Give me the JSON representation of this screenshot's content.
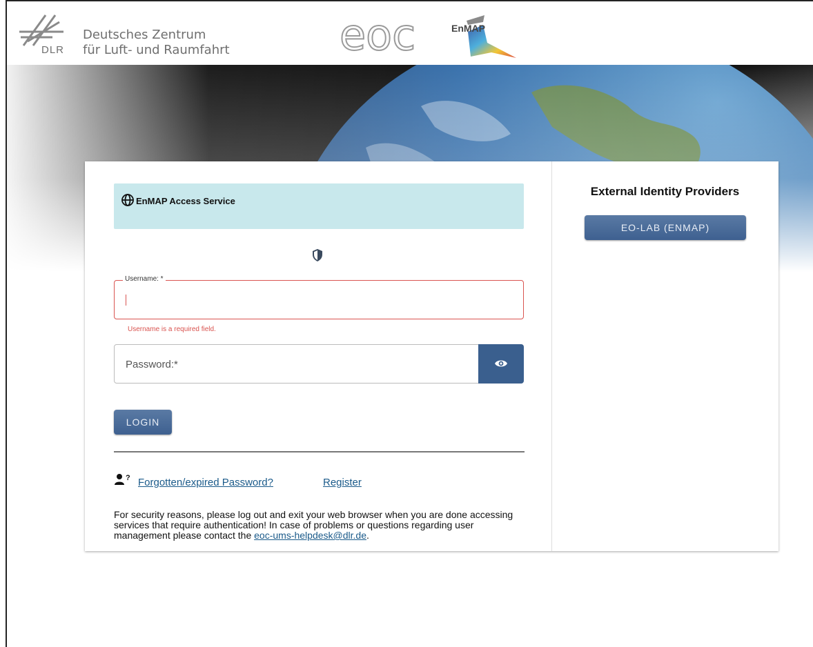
{
  "header": {
    "dlr_abbr": "DLR",
    "dlr_name_line1": "Deutsches Zentrum",
    "dlr_name_line2": "für Luft- und Raumfahrt",
    "eoc_logo_text": "eoc",
    "enmap_logo_text": "EnMAP"
  },
  "login_panel": {
    "service_title": "EnMAP Access Service",
    "username_label": "Username: *",
    "username_value": "",
    "username_error": "Username is a required field.",
    "password_label": "Password:*",
    "login_button": "LOGIN",
    "forgot_link": "Forgotten/expired Password?",
    "register_link": "Register",
    "notice_text": "For security reasons, please log out and exit your web browser when you are done accessing services that require authentication! In case of problems or questions regarding user management please contact the ",
    "notice_email": "eoc-ums-helpdesk@dlr.de",
    "notice_end": "."
  },
  "external": {
    "title": "External Identity Providers",
    "providers": [
      {
        "label": "EO-LAB (ENMAP)"
      }
    ]
  },
  "colors": {
    "accent": "#3e6090",
    "error": "#d9534f",
    "service_bg": "#c8e8ec",
    "link": "#1a5a8a"
  },
  "icons": {
    "service": "globe-icon",
    "shield": "shield-icon",
    "password_toggle": "eye-icon",
    "forgot": "user-question-icon"
  }
}
